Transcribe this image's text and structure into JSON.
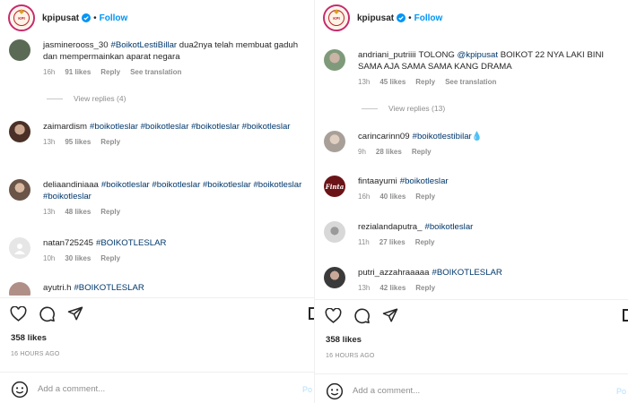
{
  "left": {
    "username": "kpipusat",
    "follow": "Follow",
    "logo_text": "KPI",
    "comments": [
      {
        "user": "jasminerooss_30",
        "parts": [
          {
            "t": "#BoikotLestiBillar",
            "tag": true
          },
          {
            "t": " dua2nya telah membuat gaduh dan mempermainkan aparat negara",
            "tag": false
          }
        ],
        "time": "16h",
        "likes": "91 likes",
        "reply": "Reply",
        "translate": "See translation",
        "avatar": "#5a6a55"
      },
      {
        "user": "zaimardism",
        "parts": [
          {
            "t": "#boikotleslar #boikotleslar #boikotleslar #boikotleslar",
            "tag": true
          }
        ],
        "time": "13h",
        "likes": "95 likes",
        "reply": "Reply",
        "avatar": "#7a5a48"
      },
      {
        "user": "deliaandiniaaa",
        "parts": [
          {
            "t": "#boikotleslar #boikotleslar #boikotleslar #boikotleslar #boikotleslar",
            "tag": true
          }
        ],
        "time": "13h",
        "likes": "48 likes",
        "reply": "Reply",
        "avatar": "#8a7a6a"
      },
      {
        "user": "natan725245",
        "parts": [
          {
            "t": "#BOIKOTLESLAR",
            "tag": true
          }
        ],
        "time": "10h",
        "likes": "30 likes",
        "reply": "Reply",
        "avatar": "#dcdcdc"
      },
      {
        "user": "ayutri.h",
        "parts": [
          {
            "t": "#BOIKOTLESLAR",
            "tag": true
          }
        ],
        "time": "",
        "likes": "",
        "reply": "",
        "avatar": "#b08f88"
      }
    ],
    "view_replies": "View replies (4)",
    "likes_total": "358 likes",
    "time_ago": "16 HOURS AGO",
    "add_comment_placeholder": "Add a comment...",
    "post_label": "Po"
  },
  "right": {
    "username": "kpipusat",
    "follow": "Follow",
    "logo_text": "KPI",
    "comments": [
      {
        "user": "andriani_putriiii",
        "parts": [
          {
            "t": "TOLONG ",
            "tag": false
          },
          {
            "t": "@kpipusat",
            "tag": true
          },
          {
            "t": " BOIKOT 22 NYA LAKI BINI SAMA AJA SAMA SAMA KANG DRAMA",
            "tag": false
          }
        ],
        "time": "13h",
        "likes": "45 likes",
        "reply": "Reply",
        "translate": "See translation",
        "avatar": "#7f9a7a"
      },
      {
        "user": "carincarinn09",
        "parts": [
          {
            "t": "#boikotlestibilar",
            "tag": true
          },
          {
            "t": "💧",
            "tag": false
          }
        ],
        "time": "9h",
        "likes": "28 likes",
        "reply": "Reply",
        "avatar": "#a8a098"
      },
      {
        "user": "fintaayumi",
        "parts": [
          {
            "t": "#boikotleslar",
            "tag": true
          }
        ],
        "time": "16h",
        "likes": "40 likes",
        "reply": "Reply",
        "avatar": "#6b1418",
        "avatar_text": "Finta"
      },
      {
        "user": "rezialandaputra_",
        "parts": [
          {
            "t": "#boikotleslar",
            "tag": true
          }
        ],
        "time": "11h",
        "likes": "27 likes",
        "reply": "Reply",
        "avatar": "#c8c8c8"
      },
      {
        "user": "putri_azzahraaaaa",
        "parts": [
          {
            "t": "#BOIKOTLESLAR",
            "tag": true
          }
        ],
        "time": "13h",
        "likes": "42 likes",
        "reply": "Reply",
        "avatar": "#3a3a3a"
      }
    ],
    "view_replies": "View replies (13)",
    "likes_total": "358 likes",
    "time_ago": "16 HOURS AGO",
    "add_comment_placeholder": "Add a comment...",
    "post_label": "Po"
  }
}
